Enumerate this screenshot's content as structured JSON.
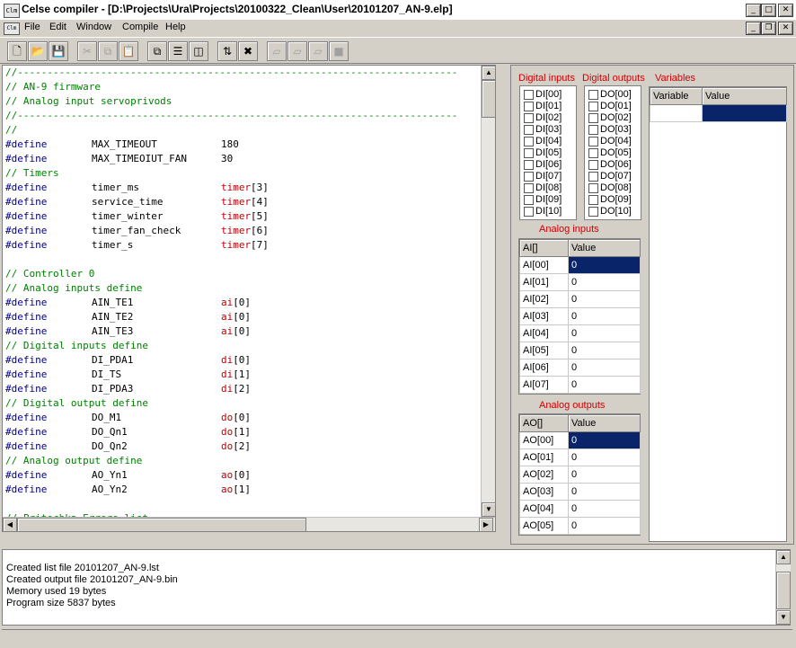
{
  "window": {
    "app_icon_text": "Clm",
    "title": "Celse compiler - [D:\\Projects\\Ura\\Projects\\20100322_Clean\\User\\20101207_AN-9.elp]"
  },
  "menu": [
    "File",
    "Edit",
    "Window",
    "Compile",
    "Help"
  ],
  "toolbar": {
    "buttons": [
      "new-file-icon",
      "open-folder-icon",
      "save-icon",
      "cut-icon",
      "copy-icon",
      "paste-icon",
      "cascade-icon",
      "tile-horizontal-icon",
      "tile-vertical-icon",
      "compile-icon",
      "tools-icon",
      "step-1-icon",
      "step-2-icon",
      "step-3-icon",
      "stop-icon"
    ]
  },
  "editor": {
    "lines": [
      {
        "t": "c",
        "text": "//--------------------------------------------------------------------------"
      },
      {
        "t": "c",
        "text": "// AN-9 firmware"
      },
      {
        "t": "c",
        "text": "// Analog input servoprivods"
      },
      {
        "t": "c",
        "text": "//--------------------------------------------------------------------------"
      },
      {
        "t": "c",
        "text": "//"
      },
      {
        "t": "d",
        "kw": "#define",
        "name": "MAX_TIMEOUT",
        "val": "180"
      },
      {
        "t": "d",
        "kw": "#define",
        "name": "MAX_TIMEOIUT_FAN",
        "val": "30"
      },
      {
        "t": "c",
        "text": "// Timers"
      },
      {
        "t": "d",
        "kw": "#define",
        "name": "timer_ms",
        "arr": "timer",
        "idx": "[3]"
      },
      {
        "t": "d",
        "kw": "#define",
        "name": "service_time",
        "arr": "timer",
        "idx": "[4]"
      },
      {
        "t": "d",
        "kw": "#define",
        "name": "timer_winter",
        "arr": "timer",
        "idx": "[5]"
      },
      {
        "t": "d",
        "kw": "#define",
        "name": "timer_fan_check",
        "arr": "timer",
        "idx": "[6]"
      },
      {
        "t": "d",
        "kw": "#define",
        "name": "timer_s",
        "arr": "timer",
        "idx": "[7]"
      },
      {
        "t": "b",
        "text": ""
      },
      {
        "t": "c",
        "text": "// Controller 0"
      },
      {
        "t": "c",
        "text": "// Analog inputs define"
      },
      {
        "t": "d",
        "kw": "#define",
        "name": "AIN_TE1",
        "arr": "ai",
        "idx": "[0]"
      },
      {
        "t": "d",
        "kw": "#define",
        "name": "AIN_TE2",
        "arr": "ai",
        "idx": "[0]"
      },
      {
        "t": "d",
        "kw": "#define",
        "name": "AIN_TE3",
        "arr": "ai",
        "idx": "[0]"
      },
      {
        "t": "c",
        "text": "// Digital inputs define"
      },
      {
        "t": "d",
        "kw": "#define",
        "name": "DI_PDA1",
        "arr": "di",
        "idx": "[0]"
      },
      {
        "t": "d",
        "kw": "#define",
        "name": "DI_TS",
        "arr": "di",
        "idx": "[1]"
      },
      {
        "t": "d",
        "kw": "#define",
        "name": "DI_PDA3",
        "arr": "di",
        "idx": "[2]"
      },
      {
        "t": "c",
        "text": "// Digital output define"
      },
      {
        "t": "d",
        "kw": "#define",
        "name": "DO_M1",
        "arr": "do",
        "idx": "[0]"
      },
      {
        "t": "d",
        "kw": "#define",
        "name": "DO_Qn1",
        "arr": "do",
        "idx": "[1]"
      },
      {
        "t": "d",
        "kw": "#define",
        "name": "DO_Qn2",
        "arr": "do",
        "idx": "[2]"
      },
      {
        "t": "c",
        "text": "// Analog output define"
      },
      {
        "t": "d",
        "kw": "#define",
        "name": "AO_Yn1",
        "arr": "ao",
        "idx": "[0]"
      },
      {
        "t": "d",
        "kw": "#define",
        "name": "AO_Yn2",
        "arr": "ao",
        "idx": "[1]"
      },
      {
        "t": "b",
        "text": ""
      },
      {
        "t": "c",
        "text": "// Pritochka Errors list"
      }
    ]
  },
  "panels": {
    "digital_inputs_label": "Digital inputs",
    "digital_outputs_label": "Digital outputs",
    "variables_label": "Variables",
    "digital_inputs": [
      "DI[00]",
      "DI[01]",
      "DI[02]",
      "DI[03]",
      "DI[04]",
      "DI[05]",
      "DI[06]",
      "DI[07]",
      "DI[08]",
      "DI[09]",
      "DI[10]"
    ],
    "digital_outputs": [
      "DO[00]",
      "DO[01]",
      "DO[02]",
      "DO[03]",
      "DO[04]",
      "DO[05]",
      "DO[06]",
      "DO[07]",
      "DO[08]",
      "DO[09]",
      "DO[10]"
    ],
    "variables_headers": [
      "Variable",
      "Value"
    ],
    "analog_inputs_label": "Analog inputs",
    "analog_inputs_headers": [
      "AI[]",
      "Value"
    ],
    "analog_inputs": [
      [
        "AI[00]",
        "0"
      ],
      [
        "AI[01]",
        "0"
      ],
      [
        "AI[02]",
        "0"
      ],
      [
        "AI[03]",
        "0"
      ],
      [
        "AI[04]",
        "0"
      ],
      [
        "AI[05]",
        "0"
      ],
      [
        "AI[06]",
        "0"
      ],
      [
        "AI[07]",
        "0"
      ]
    ],
    "analog_outputs_label": "Analog outputs",
    "analog_outputs_headers": [
      "AO[]",
      "Value"
    ],
    "analog_outputs": [
      [
        "AO[00]",
        "0"
      ],
      [
        "AO[01]",
        "0"
      ],
      [
        "AO[02]",
        "0"
      ],
      [
        "AO[03]",
        "0"
      ],
      [
        "AO[04]",
        "0"
      ],
      [
        "AO[05]",
        "0"
      ]
    ]
  },
  "output": {
    "lines": [
      "Created list file 20101207_AN-9.lst",
      "Created output file 20101207_AN-9.bin",
      "Memory used 19 bytes",
      "Program size 5837 bytes"
    ]
  },
  "colors": {
    "selection": "#0a246a",
    "comment": "#008000",
    "define": "#000080",
    "array": "#c00000",
    "panel_label": "#d00000"
  }
}
